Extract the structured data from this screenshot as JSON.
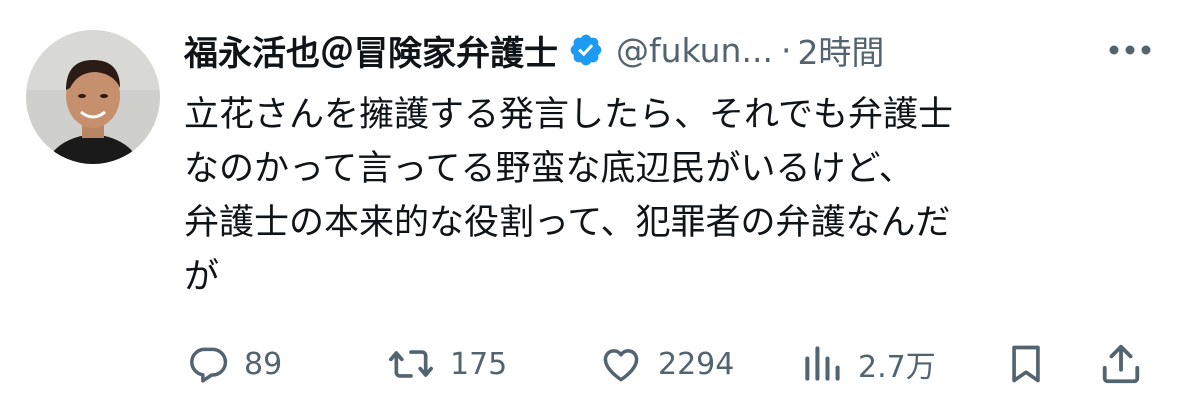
{
  "tweet": {
    "display_name": "福永活也＠冒険家弁護士",
    "handle": "@fukun...",
    "separator": "·",
    "time": "2時間",
    "verified_color": "#1d9bf0",
    "body_lines": [
      "立花さんを擁護する発言したら、それでも弁護士",
      "なのかって言ってる野蛮な底辺民がいるけど、",
      "弁護士の本来的な役割って、犯罪者の弁護なんだ",
      "が"
    ],
    "actions": {
      "reply": {
        "icon": "reply-icon",
        "count": "89"
      },
      "retweet": {
        "icon": "retweet-icon",
        "count": "175"
      },
      "like": {
        "icon": "heart-icon",
        "count": "2294"
      },
      "views": {
        "icon": "views-icon",
        "count": "2.7万"
      },
      "bookmark": {
        "icon": "bookmark-icon"
      },
      "share": {
        "icon": "share-icon"
      }
    },
    "more_icon": "more-icon"
  }
}
